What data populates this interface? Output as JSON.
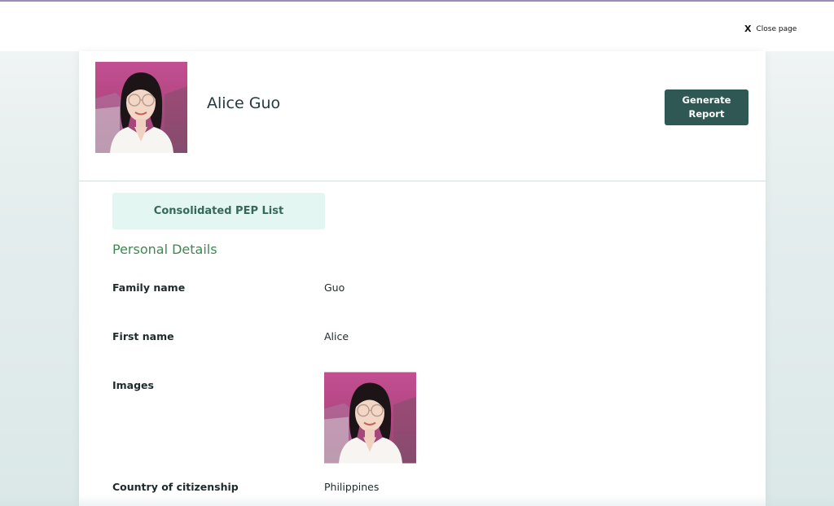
{
  "top_bar": {
    "close_icon_glyph": "X",
    "close_label": "Close page"
  },
  "profile": {
    "name": "Alice Guo",
    "photo_icon": "portrait-photo"
  },
  "actions": {
    "generate_report_label": "Generate\nReport"
  },
  "source_tab": {
    "label": "Consolidated PEP List"
  },
  "personal_details": {
    "title": "Personal Details",
    "fields": [
      {
        "label": "Family name",
        "value": "Guo"
      },
      {
        "label": "First name",
        "value": "Alice"
      },
      {
        "label": "Images",
        "value": ""
      },
      {
        "label": "Country of citizenship",
        "value": "Philippines"
      }
    ]
  },
  "colors": {
    "accent_button": "#2f5753",
    "section_title": "#3b8a4f",
    "tab_background": "#e4f6f1",
    "tab_text": "#35685b",
    "top_line": "#9c8cb5"
  }
}
